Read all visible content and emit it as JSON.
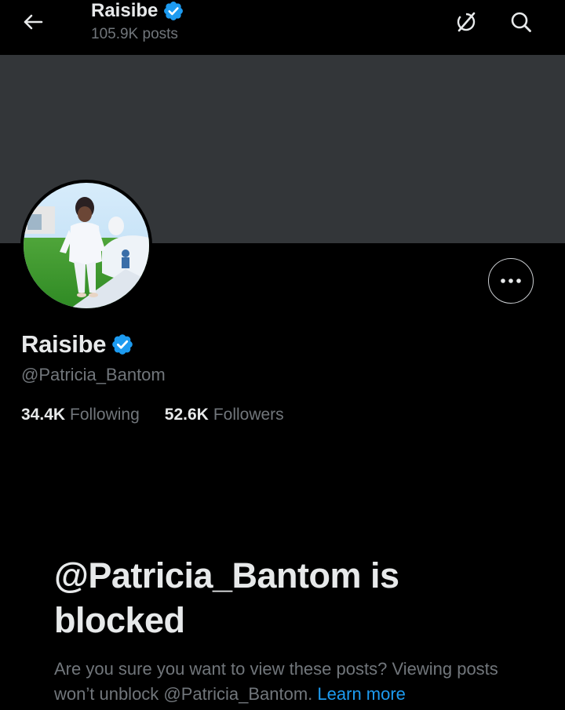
{
  "header": {
    "name": "Raisibe",
    "posts_count": "105.9K posts"
  },
  "profile": {
    "name": "Raisibe",
    "handle": "@Patricia_Bantom",
    "following_count": "34.4K",
    "following_label": "Following",
    "followers_count": "52.6K",
    "followers_label": "Followers"
  },
  "blocked": {
    "title": "@Patricia_Bantom is blocked",
    "description": "Are you sure you want to view these posts? Viewing posts won’t unblock @Patricia_Bantom.",
    "learn_more": "Learn more"
  },
  "icons": {
    "back": "arrow-left-icon",
    "grok": "grok-icon",
    "search": "search-icon",
    "verified": "verified-badge-icon",
    "more": "more-dots-icon"
  },
  "colors": {
    "background": "#000000",
    "banner": "#333639",
    "primary_text": "#e7e9ea",
    "secondary_text": "#71767b",
    "link": "#1d9bf0",
    "verified": "#1d9bf0"
  }
}
